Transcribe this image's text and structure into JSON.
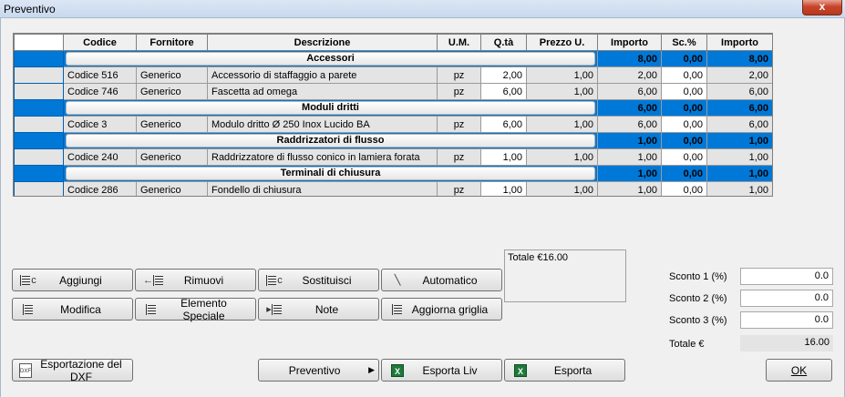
{
  "window": {
    "title": "Preventivo",
    "close_label": "x"
  },
  "columns": [
    "Codice",
    "Fornitore",
    "Descrizione",
    "U.M.",
    "Q.tà",
    "Prezzo U.",
    "Importo",
    "Sc.%",
    "Importo"
  ],
  "groups": [
    {
      "name": "Accessori",
      "importo": "8,00",
      "sconto": "0,00",
      "totale": "8,00",
      "items": [
        {
          "codice": "Codice 516",
          "fornitore": "Generico",
          "descrizione": "Accessorio di staffaggio a parete",
          "um": "pz",
          "qta": "2,00",
          "prezzo": "1,00",
          "importo": "2,00",
          "sconto": "0,00",
          "totale": "2,00"
        },
        {
          "codice": "Codice 746",
          "fornitore": "Generico",
          "descrizione": "Fascetta ad omega",
          "um": "pz",
          "qta": "6,00",
          "prezzo": "1,00",
          "importo": "6,00",
          "sconto": "0,00",
          "totale": "6,00"
        }
      ]
    },
    {
      "name": "Moduli dritti",
      "importo": "6,00",
      "sconto": "0,00",
      "totale": "6,00",
      "items": [
        {
          "codice": "Codice 3",
          "fornitore": "Generico",
          "descrizione": "Modulo dritto Ø 250 Inox Lucido BA",
          "um": "pz",
          "qta": "6,00",
          "prezzo": "1,00",
          "importo": "6,00",
          "sconto": "0,00",
          "totale": "6,00"
        }
      ]
    },
    {
      "name": "Raddrizzatori di flusso",
      "importo": "1,00",
      "sconto": "0,00",
      "totale": "1,00",
      "items": [
        {
          "codice": "Codice 240",
          "fornitore": "Generico",
          "descrizione": "Raddrizzatore di flusso conico in lamiera forata",
          "um": "pz",
          "qta": "1,00",
          "prezzo": "1,00",
          "importo": "1,00",
          "sconto": "0,00",
          "totale": "1,00"
        }
      ]
    },
    {
      "name": "Terminali di chiusura",
      "importo": "1,00",
      "sconto": "0,00",
      "totale": "1,00",
      "items": [
        {
          "codice": "Codice 286",
          "fornitore": "Generico",
          "descrizione": "Fondello di chiusura",
          "um": "pz",
          "qta": "1,00",
          "prezzo": "1,00",
          "importo": "1,00",
          "sconto": "0,00",
          "totale": "1,00"
        }
      ]
    }
  ],
  "buttons": {
    "aggiungi": "Aggiungi",
    "rimuovi": "Rimuovi",
    "sostituisci": "Sostituisci",
    "automatico": "Automatico",
    "modifica": "Modifica",
    "elemento_speciale": "Elemento Speciale",
    "note": "Note",
    "aggiorna_griglia": "Aggiorna griglia",
    "esporta_dxf": "Esportazione del DXF",
    "preventivo": "Preventivo",
    "esporta_liv": "Esporta Liv",
    "esporta": "Esporta",
    "ok": "OK"
  },
  "icons": {
    "dxf_label": "DXF",
    "excel_label": "X"
  },
  "summary_text": "Totale €16.00",
  "discounts": [
    {
      "label": "Sconto 1 (%)",
      "value": "0.0"
    },
    {
      "label": "Sconto 2 (%)",
      "value": "0.0"
    },
    {
      "label": "Sconto 3 (%)",
      "value": "0.0"
    }
  ],
  "total": {
    "label": "Totale €",
    "value": "16.00"
  },
  "colors": {
    "selection": "#0078d7",
    "close": "#c8452b"
  }
}
